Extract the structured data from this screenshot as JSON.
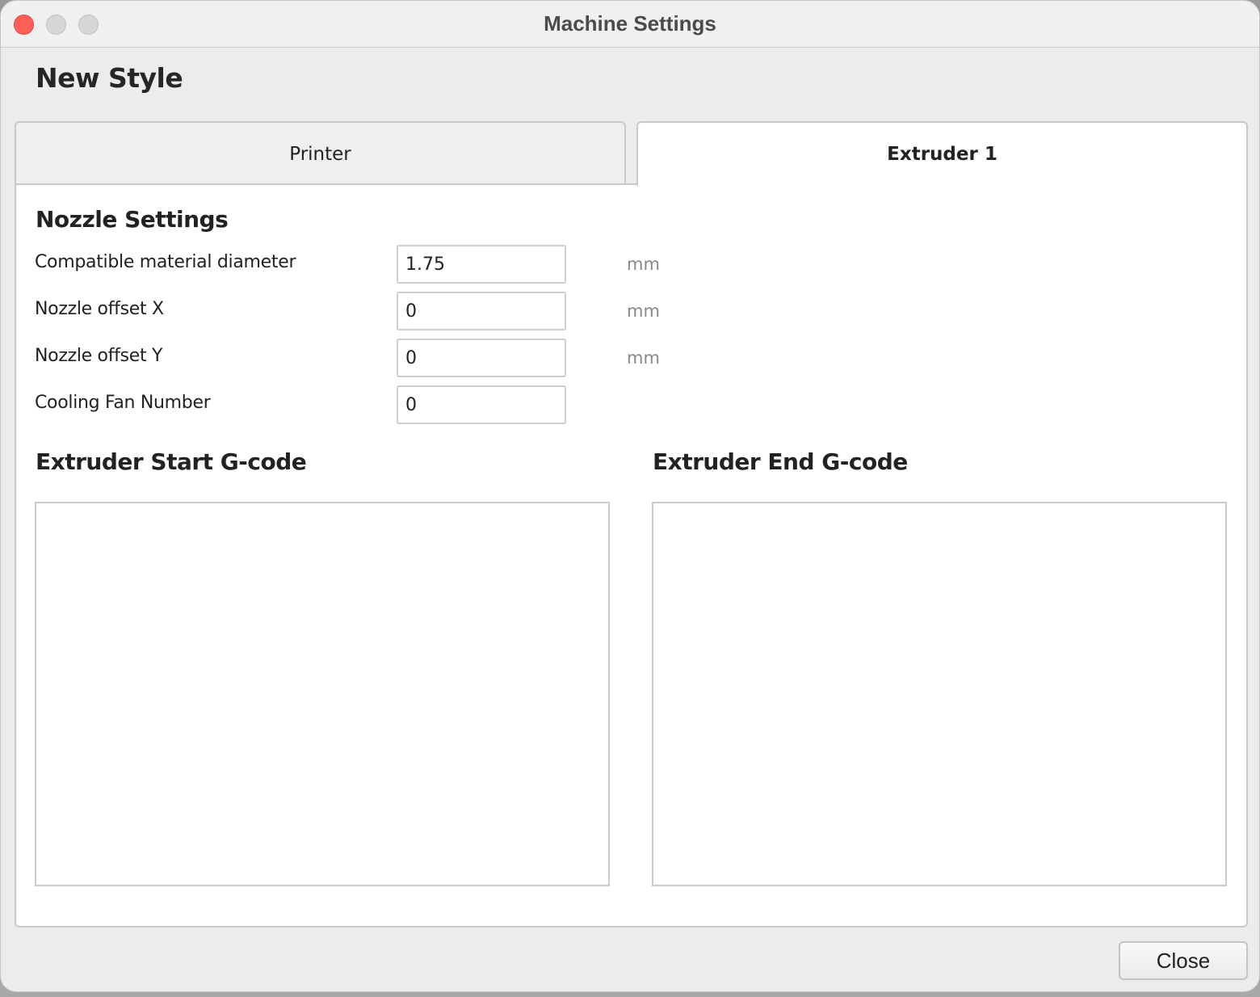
{
  "window": {
    "title": "Machine Settings",
    "controls": {
      "close": "close-window",
      "minimize": "minimize-window",
      "maximize": "maximize-window"
    },
    "close_color": "#fe5f57"
  },
  "header": {
    "style_name": "New Style"
  },
  "tabs": [
    {
      "label": "Printer",
      "active": false
    },
    {
      "label": "Extruder 1",
      "active": true
    }
  ],
  "nozzle_settings": {
    "title": "Nozzle Settings",
    "fields": [
      {
        "label": "Compatible material diameter",
        "value": "1.75",
        "unit": "mm"
      },
      {
        "label": "Nozzle offset X",
        "value": "0",
        "unit": "mm"
      },
      {
        "label": "Nozzle offset Y",
        "value": "0",
        "unit": "mm"
      },
      {
        "label": "Cooling Fan Number",
        "value": "0",
        "unit": ""
      }
    ]
  },
  "gcode": {
    "start_title": "Extruder Start G-code",
    "start_value": "",
    "end_title": "Extruder End G-code",
    "end_value": ""
  },
  "footer": {
    "close_label": "Close"
  }
}
